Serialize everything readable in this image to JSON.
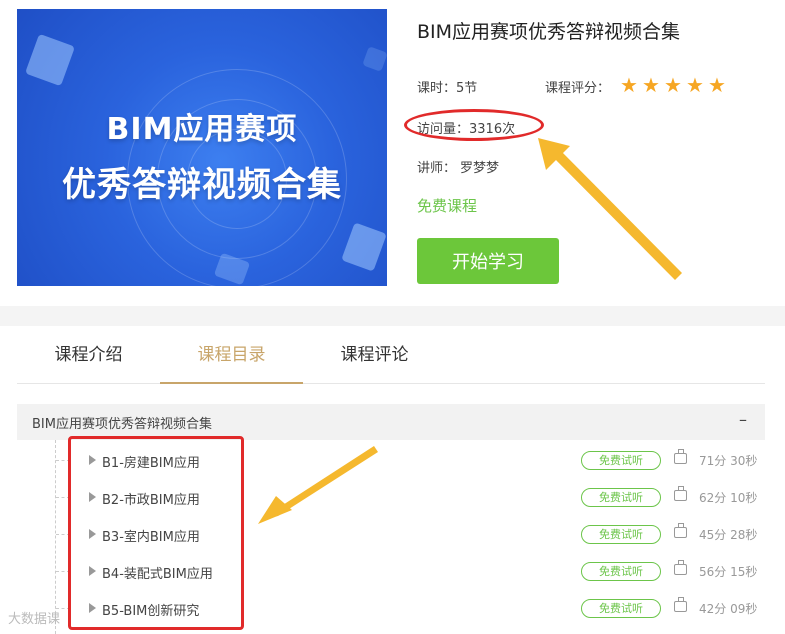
{
  "banner": {
    "line1": "BIM应用赛项",
    "line2": "优秀答辩视频合集"
  },
  "course": {
    "title": "BIM应用赛项优秀答辩视频合集",
    "lessons_label": "课时：",
    "lessons_value": "5节",
    "rating_label": "课程评分：",
    "rating_stars": 5,
    "visits_label": "访问量：",
    "visits_value": "3316次",
    "teacher_label": "讲师：",
    "teacher_value": "罗梦梦",
    "free_label": "免费课程",
    "start_button": "开始学习"
  },
  "tabs": [
    {
      "label": "课程介绍",
      "active": false
    },
    {
      "label": "课程目录",
      "active": true
    },
    {
      "label": "课程评论",
      "active": false
    }
  ],
  "section": {
    "title": "BIM应用赛项优秀答辩视频合集",
    "collapse_symbol": "–"
  },
  "lessons": [
    {
      "name": "B1-房建BIM应用",
      "badge": "免费试听",
      "duration": "71分 30秒"
    },
    {
      "name": "B2-市政BIM应用",
      "badge": "免费试听",
      "duration": "62分 10秒"
    },
    {
      "name": "B3-室内BIM应用",
      "badge": "免费试听",
      "duration": "45分 28秒"
    },
    {
      "name": "B4-装配式BIM应用",
      "badge": "免费试听",
      "duration": "56分 15秒"
    },
    {
      "name": "B5-BIM创新研究",
      "badge": "免费试听",
      "duration": "42分 09秒"
    }
  ],
  "watermark": "大数据课",
  "colors": {
    "accent_green": "#6cc54a",
    "tab_active": "#c8a56a",
    "highlight_red": "#e12a2a",
    "arrow_yellow": "#f5b82e"
  }
}
